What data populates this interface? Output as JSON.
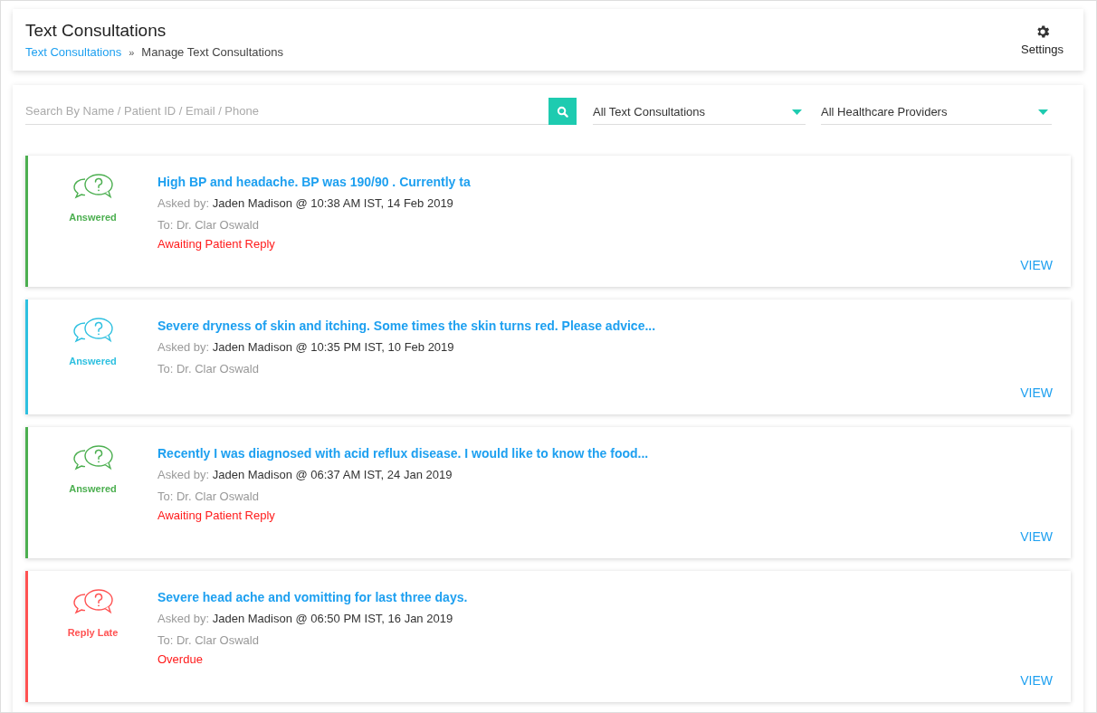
{
  "header": {
    "title": "Text Consultations",
    "breadcrumb": [
      {
        "label": "Text Consultations",
        "kind": "link"
      },
      {
        "label": "»",
        "kind": "separator"
      },
      {
        "label": "Manage Text Consultations",
        "kind": "current"
      }
    ],
    "settings_label": "Settings"
  },
  "filters": {
    "search": {
      "placeholder": "Search By Name / Patient ID / Email / Phone"
    },
    "type_select": "All Text Consultations",
    "provider_select": "All Healthcare Providers"
  },
  "consultations": [
    {
      "status": "Answered",
      "color": "#4caf50",
      "title": "High BP and headache. BP was 190/90 . Currently ta",
      "asked_by_label": "Asked by:",
      "asked_by": "Jaden Madison @ 10:38 AM IST, 14 Feb 2019",
      "to": "To: Dr. Clar Oswald",
      "note": "Awaiting Patient Reply",
      "action": "VIEW"
    },
    {
      "status": "Answered",
      "color": "#2ec0e0",
      "title": "Severe dryness of skin and itching. Some times the skin turns red. Please advice...",
      "asked_by_label": "Asked by:",
      "asked_by": "Jaden Madison @ 10:35 PM IST, 10 Feb 2019",
      "to": "To: Dr. Clar Oswald",
      "action": "VIEW"
    },
    {
      "status": "Answered",
      "color": "#4caf50",
      "title": "Recently I was diagnosed with acid reflux disease. I would like to know the food...",
      "asked_by_label": "Asked by:",
      "asked_by": "Jaden Madison @ 06:37 AM IST, 24 Jan 2019",
      "to": "To: Dr. Clar Oswald",
      "note": "Awaiting Patient Reply",
      "action": "VIEW"
    },
    {
      "status": "Reply Late",
      "color": "#ff5252",
      "title": "Severe head ache and vomitting for last three days.",
      "asked_by_label": "Asked by:",
      "asked_by": "Jaden Madison @ 06:50 PM IST, 16 Jan 2019",
      "to": "To: Dr. Clar Oswald",
      "note": "Overdue",
      "action": "VIEW"
    }
  ]
}
